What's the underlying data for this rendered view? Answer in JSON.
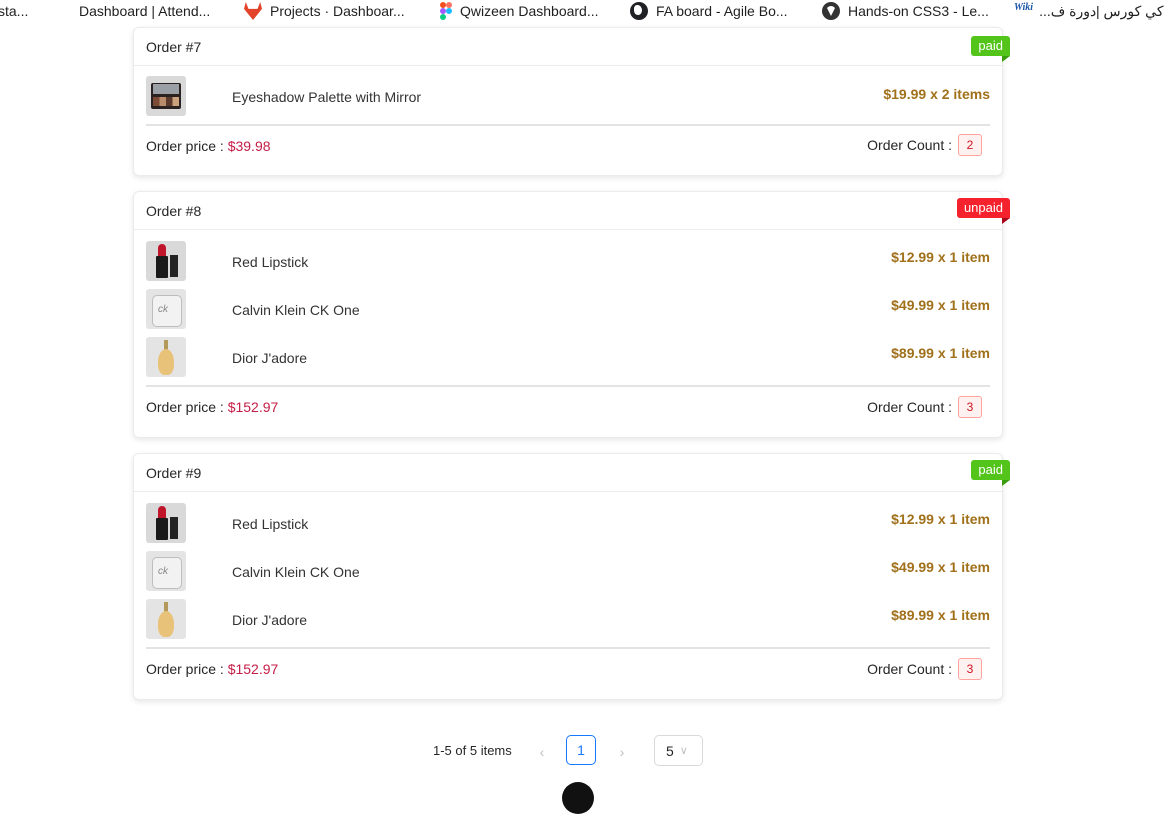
{
  "bookmarks": [
    {
      "label": "sta...",
      "icon": "none"
    },
    {
      "label": "Dashboard | Attend...",
      "icon": "none"
    },
    {
      "label": "Projects · Dashboar...",
      "icon": "gitlab-icon"
    },
    {
      "label": "Qwizeen Dashboard...",
      "icon": "figma-icon"
    },
    {
      "label": "FA board - Agile Bo...",
      "icon": "globe-icon"
    },
    {
      "label": "Hands-on CSS3 - Le...",
      "icon": "freecodecamp-icon"
    },
    {
      "label": "Wiki",
      "icon": "wiki-icon"
    },
    {
      "label": "دورة ف...",
      "icon": "none"
    },
    {
      "label": "كي كورس |",
      "icon": "none"
    }
  ],
  "orders": [
    {
      "title": "Order #7",
      "status": "paid",
      "items": [
        {
          "name": "Eyeshadow Palette with Mirror",
          "price": "$19.99 x 2 items",
          "thumb": "eyeshadow-palette"
        }
      ],
      "price_label": "Order price :",
      "price": "$39.98",
      "count_label": "Order Count :",
      "count": "2"
    },
    {
      "title": "Order #8",
      "status": "unpaid",
      "items": [
        {
          "name": "Red Lipstick",
          "price": "$12.99 x 1 item",
          "thumb": "red-lipstick"
        },
        {
          "name": "Calvin Klein CK One",
          "price": "$49.99 x 1 item",
          "thumb": "ck-one-bottle"
        },
        {
          "name": "Dior J'adore",
          "price": "$89.99 x 1 item",
          "thumb": "dior-jadore-bottle"
        }
      ],
      "price_label": "Order price :",
      "price": "$152.97",
      "count_label": "Order Count :",
      "count": "3"
    },
    {
      "title": "Order #9",
      "status": "paid",
      "items": [
        {
          "name": "Red Lipstick",
          "price": "$12.99 x 1 item",
          "thumb": "red-lipstick"
        },
        {
          "name": "Calvin Klein CK One",
          "price": "$49.99 x 1 item",
          "thumb": "ck-one-bottle"
        },
        {
          "name": "Dior J'adore",
          "price": "$89.99 x 1 item",
          "thumb": "dior-jadore-bottle"
        }
      ],
      "price_label": "Order price :",
      "price": "$152.97",
      "count_label": "Order Count :",
      "count": "3"
    }
  ],
  "pagination": {
    "total_text": "1-5 of 5 items",
    "prev": "‹",
    "next": "›",
    "current_page": "1",
    "page_size": "5",
    "page_size_chevron": "∨"
  },
  "colors": {
    "paid": "#52c41a",
    "unpaid": "#f5222d",
    "price": "#c41d45",
    "item_price": "#a0701a",
    "accent": "#1677ff"
  }
}
